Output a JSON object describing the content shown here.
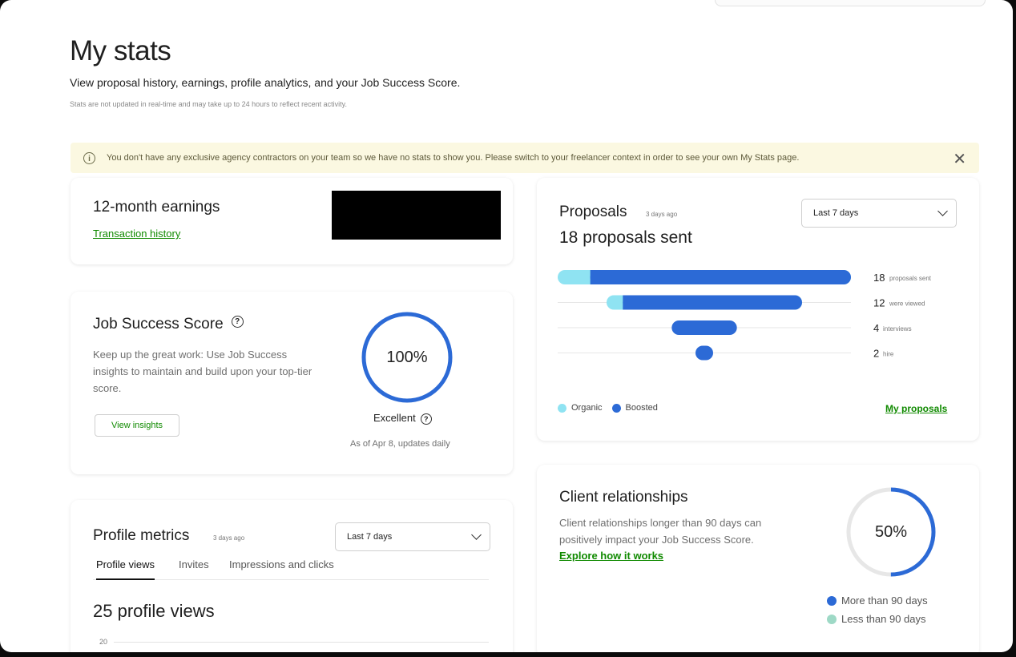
{
  "page": {
    "title": "My stats",
    "subtitle": "View proposal history, earnings, profile analytics, and your Job Success Score.",
    "note": "Stats are not updated in real-time and may take up to 24 hours to reflect recent activity."
  },
  "banner": {
    "message": "You don't have any exclusive agency contractors on your team so we have no stats to show you. Please switch to your freelancer context in order to see your own My Stats page.",
    "close_icon": "✕"
  },
  "earnings": {
    "title": "12-month earnings",
    "link": "Transaction history"
  },
  "jss": {
    "title": "Job Success Score",
    "description": "Keep up the great work: Use Job Success insights to maintain and build upon your top-tier score.",
    "button": "View insights",
    "score_label": "100%",
    "score_value": 100,
    "rating": "Excellent",
    "as_of": "As of Apr 8, updates daily",
    "ring_color": "#2c6ad6"
  },
  "profile_metrics": {
    "title": "Profile metrics",
    "updated": "3 days ago",
    "select_value": "Last 7 days",
    "tabs": [
      {
        "label": "Profile views",
        "active": true
      },
      {
        "label": "Invites",
        "active": false
      },
      {
        "label": "Impressions and clicks",
        "active": false
      }
    ],
    "views": "25 profile views",
    "axis_top": "20"
  },
  "proposals": {
    "title": "Proposals",
    "updated": "3 days ago",
    "count": "18 proposals sent",
    "select_value": "Last 7 days",
    "funnel": [
      {
        "number": "18",
        "label": "proposals sent",
        "organic": 2,
        "boosted": 16
      },
      {
        "number": "12",
        "label": "were viewed",
        "organic": 1,
        "boosted": 11
      },
      {
        "number": "4",
        "label": "interviews",
        "organic": 0,
        "boosted": 4
      },
      {
        "number": "2",
        "label": "hire",
        "organic": 0,
        "boosted": 1
      }
    ],
    "max": 18,
    "legend": [
      {
        "label": "Organic",
        "color": "#8fe3f2"
      },
      {
        "label": "Boosted",
        "color": "#2c6ad6"
      }
    ],
    "link": "My proposals"
  },
  "clients": {
    "title": "Client relationships",
    "description": "Client relationships longer than 90 days can positively impact your Job Success Score.",
    "link": "Explore how it works",
    "percent_label": "50%",
    "percent_value": 50,
    "legend": [
      {
        "label": "More than 90 days",
        "color": "#2c6ad6"
      },
      {
        "label": "Less than 90 days",
        "color": "#9ed9c6"
      }
    ],
    "track_color": "#e7e7e7"
  }
}
